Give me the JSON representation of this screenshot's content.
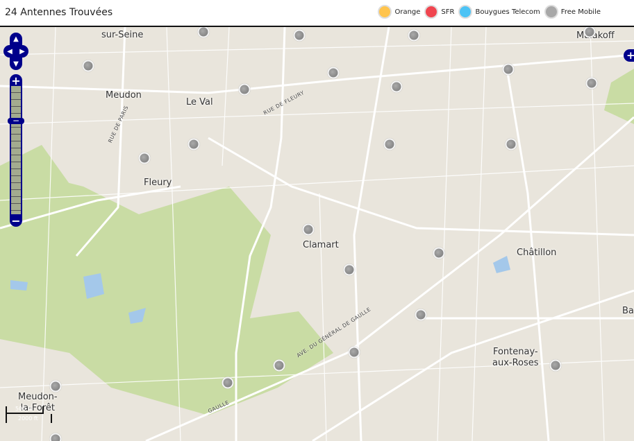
{
  "header": {
    "title": "24 Antennes Trouvées"
  },
  "legend": [
    {
      "label": "Orange",
      "color": "#ffc44d"
    },
    {
      "label": "SFR",
      "color": "#f0454f"
    },
    {
      "label": "Bouygues Telecom",
      "color": "#4cc3f5"
    },
    {
      "label": "Free Mobile",
      "color": "#a8a8a8"
    }
  ],
  "map": {
    "places": [
      "sur-Seine",
      "Meudon",
      "Le Val",
      "Fleury",
      "Clamart",
      "Châtillon",
      "Fontenay-\naux-Roses",
      "Meudon-\nla-Forêt",
      "Malakoff",
      "Ba"
    ],
    "streets": [
      "RUE DE FLEURY",
      "RUE DE PARIS",
      "AVE. DU GÉNÉRAL DE GAULLE",
      "GAULLE"
    ],
    "marker_count": 24,
    "zoom_level_fraction": 0.27,
    "scale": {
      "metric": "500 m",
      "imperial": "2000 ft"
    }
  },
  "controls": {
    "zoom_in": "+",
    "zoom_out": "−",
    "layer_switcher": "+"
  }
}
